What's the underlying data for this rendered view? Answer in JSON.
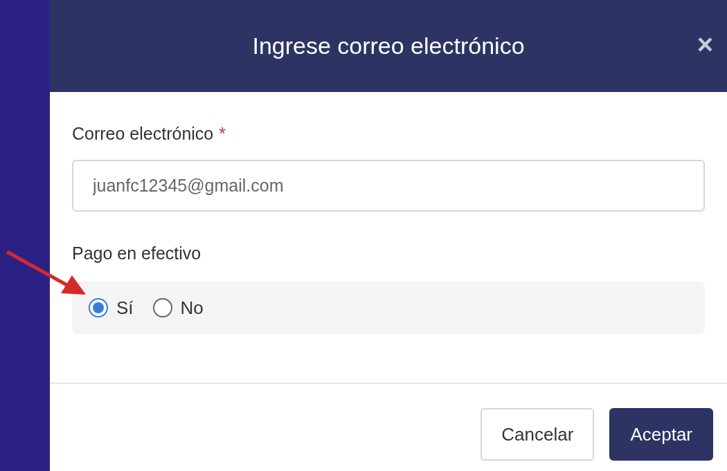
{
  "dialog": {
    "title": "Ingrese correo electrónico",
    "close": "×"
  },
  "email": {
    "label": "Correo electrónico",
    "required_mark": "*",
    "value": "juanfc12345@gmail.com"
  },
  "payment": {
    "label": "Pago en efectivo",
    "options": [
      {
        "label": "Sí",
        "selected": true
      },
      {
        "label": "No",
        "selected": false
      }
    ]
  },
  "buttons": [
    {
      "kind": "secondary",
      "label": "Cancelar"
    },
    {
      "kind": "primary",
      "label": "Aceptar"
    }
  ]
}
